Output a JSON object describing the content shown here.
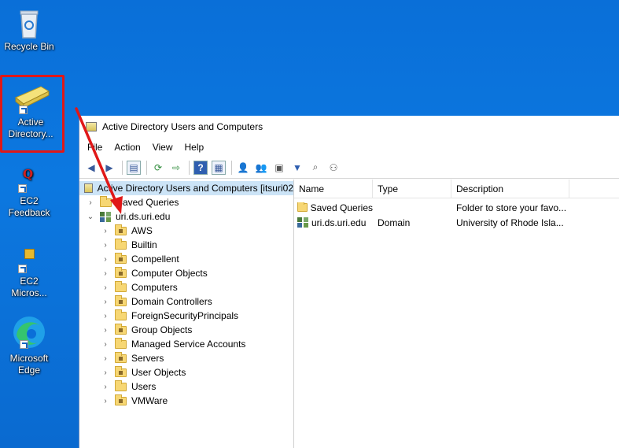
{
  "desktop": {
    "icons": [
      {
        "label": "Recycle Bin",
        "icon": "recycle-bin-icon"
      },
      {
        "label": "Active Directory...",
        "icon": "ad-users-computers-icon"
      },
      {
        "label": "EC2 Feedback",
        "icon": "ec2-feedback-icon"
      },
      {
        "label": "EC2 Micros...",
        "icon": "ec2-package-icon"
      },
      {
        "label": "Microsoft Edge",
        "icon": "edge-icon"
      }
    ]
  },
  "window": {
    "title": "Active Directory Users and Computers",
    "menu": [
      "File",
      "Action",
      "View",
      "Help"
    ]
  },
  "tree": {
    "root": "Active Directory Users and Computers [itsuri02",
    "saved_queries": "Saved Queries",
    "domain": "uri.ds.uri.edu",
    "children": [
      "AWS",
      "Builtin",
      "Compellent",
      "Computer Objects",
      "Computers",
      "Domain Controllers",
      "ForeignSecurityPrincipals",
      "Group Objects",
      "Managed Service Accounts",
      "Servers",
      "User Objects",
      "Users",
      "VMWare"
    ]
  },
  "list": {
    "columns": [
      "Name",
      "Type",
      "Description"
    ],
    "rows": [
      {
        "name": "Saved Queries",
        "type": "",
        "description": "Folder to store your favo..."
      },
      {
        "name": "uri.ds.uri.edu",
        "type": "Domain",
        "description": "University of Rhode Isla..."
      }
    ]
  },
  "colors": {
    "annotation": "#e01818",
    "desktop": "#0a6fd8",
    "selection": "#cce4f7"
  }
}
